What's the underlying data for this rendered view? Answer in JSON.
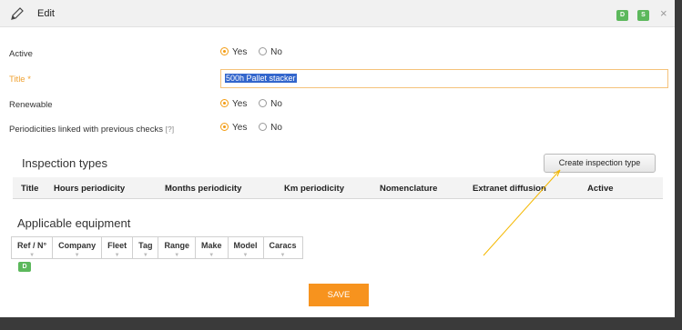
{
  "dialog": {
    "title": "Edit",
    "badges": [
      "D",
      "S"
    ],
    "close": "×"
  },
  "form": {
    "active": {
      "label": "Active",
      "yes": "Yes",
      "no": "No",
      "selected": "Yes"
    },
    "title": {
      "label": "Title *",
      "value": "500h Pallet stacker"
    },
    "renewable": {
      "label": "Renewable",
      "yes": "Yes",
      "no": "No",
      "selected": "Yes"
    },
    "periodicities": {
      "label": "Periodicities linked with previous checks",
      "help": "[?]",
      "yes": "Yes",
      "no": "No",
      "selected": "Yes"
    }
  },
  "inspection_types": {
    "heading": "Inspection types",
    "create_button": "Create inspection type",
    "columns": [
      "Title",
      "Hours periodicity",
      "Months periodicity",
      "Km periodicity",
      "Nomenclature",
      "Extranet diffusion",
      "Active"
    ]
  },
  "equipment": {
    "heading": "Applicable equipment",
    "columns": [
      "Ref / N°",
      "Company",
      "Fleet",
      "Tag",
      "Range",
      "Make",
      "Model",
      "Caracs"
    ],
    "badge": "D"
  },
  "save_label": "SAVE",
  "colors": {
    "accent": "#f7931e",
    "badge_green": "#5cb85c",
    "selection": "#3366cc"
  }
}
